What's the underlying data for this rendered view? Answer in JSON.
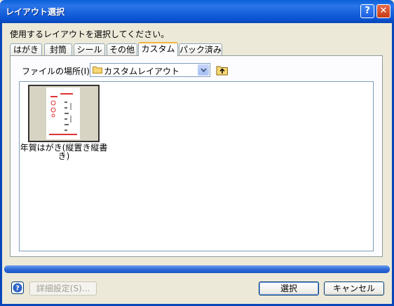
{
  "window": {
    "title": "レイアウト選択",
    "help_symbol": "?",
    "close_symbol": "✕"
  },
  "instruction": "使用するレイアウトを選択してください。",
  "tabs": [
    {
      "label": "はがき",
      "active": false
    },
    {
      "label": "封筒",
      "active": false
    },
    {
      "label": "シール",
      "active": false
    },
    {
      "label": "その他",
      "active": false
    },
    {
      "label": "カスタム",
      "active": true
    },
    {
      "label": "パック済み",
      "active": false
    }
  ],
  "location": {
    "label": "ファイルの場所(I):",
    "value": "カスタムレイアウト"
  },
  "items": [
    {
      "caption": "年賀はがき(縦置き縦書き)",
      "icon": "postcard-thumbnail"
    }
  ],
  "footer": {
    "help_icon": "question-icon",
    "detail_label": "詳細設定(S)...",
    "select_label": "選択",
    "cancel_label": "キャンセル"
  },
  "colors": {
    "titlebar": "#0a5fd8",
    "frame": "#0846b9",
    "dialog_bg": "#ece9d8",
    "progress": "#2f6ad9",
    "active_tab_accent": "#f4b23b"
  }
}
